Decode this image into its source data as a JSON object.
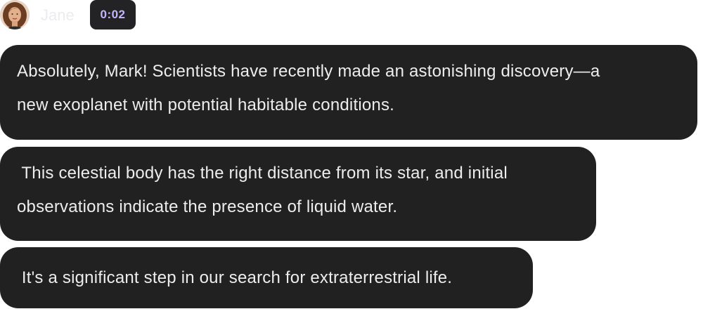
{
  "sender": {
    "name": "Jane",
    "avatar_icon": "user-avatar-photo"
  },
  "timestamp": "0:02",
  "messages": [
    {
      "lines": [
        "Absolutely, Mark! Scientists have recently made an astonishing discovery—a",
        "new exoplanet with potential habitable conditions."
      ]
    },
    {
      "lines": [
        " This celestial body has the right distance from its star, and initial",
        "observations indicate the presence of liquid water."
      ]
    },
    {
      "lines": [
        " It's a significant step in our search for extraterrestrial life."
      ]
    }
  ],
  "colors": {
    "bubble_background": "#212121",
    "bubble_text": "#ededed",
    "timestamp_background": "#232325",
    "timestamp_text": "#c4b5fd",
    "sender_name": "#ececef"
  }
}
